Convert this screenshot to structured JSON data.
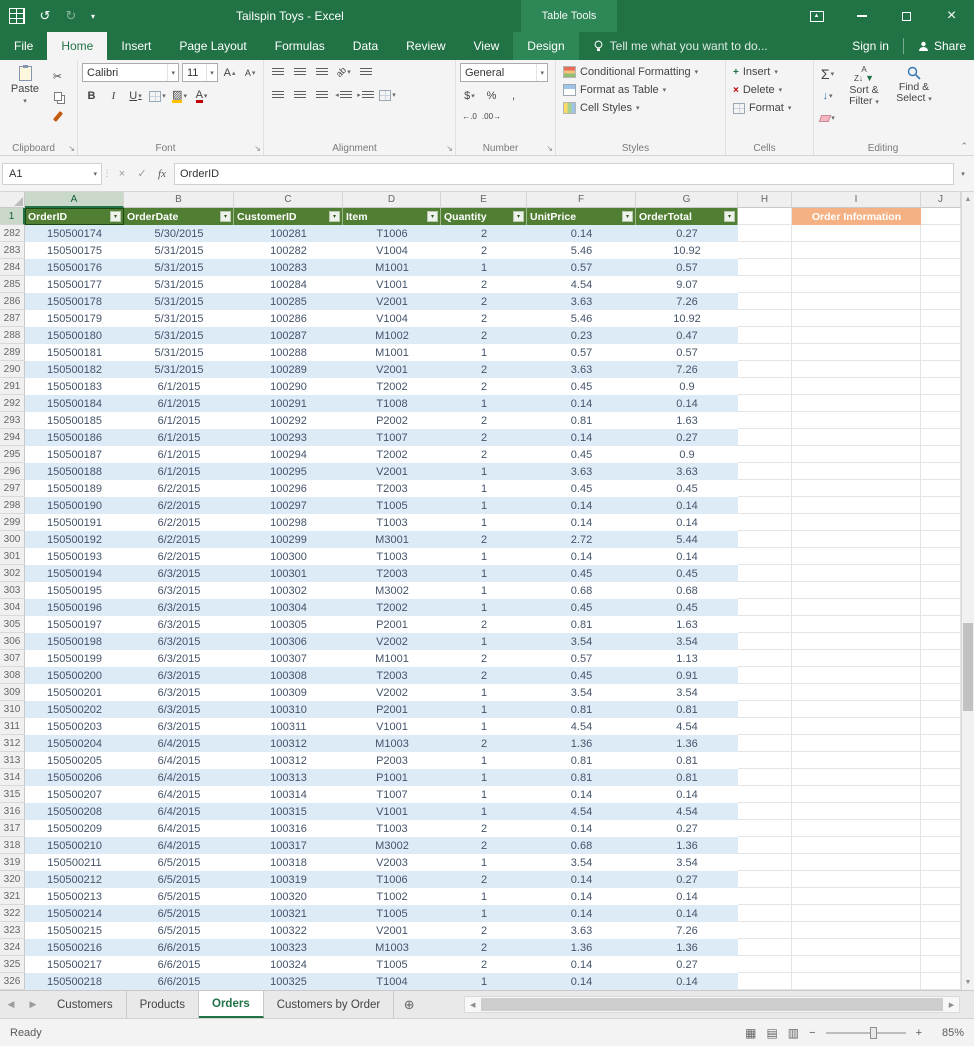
{
  "window": {
    "title": "Tailspin Toys - Excel",
    "context_label": "Table Tools"
  },
  "ribbon": {
    "tabs": [
      "File",
      "Home",
      "Insert",
      "Page Layout",
      "Formulas",
      "Data",
      "Review",
      "View",
      "Design"
    ],
    "tell_me": "Tell me what you want to do...",
    "sign_in": "Sign in",
    "share": "Share",
    "groups": {
      "clipboard": "Clipboard",
      "font": "Font",
      "alignment": "Alignment",
      "number": "Number",
      "styles": "Styles",
      "cells": "Cells",
      "editing": "Editing"
    },
    "buttons": {
      "paste": "Paste",
      "conditional_formatting": "Conditional Formatting",
      "format_as_table": "Format as Table",
      "cell_styles": "Cell Styles",
      "insert": "Insert",
      "delete": "Delete",
      "format": "Format",
      "sort_filter": "Sort & Filter",
      "find_select": "Find & Select"
    },
    "font_name": "Calibri",
    "font_size": "11",
    "number_format": "General"
  },
  "formula_bar": {
    "name_box": "A1",
    "content": "OrderID"
  },
  "sheet": {
    "columns": [
      "A",
      "B",
      "C",
      "D",
      "E",
      "F",
      "G",
      "H",
      "I",
      "J"
    ],
    "frozen_row_number": "1",
    "table_headers": [
      "OrderID",
      "OrderDate",
      "CustomerID",
      "Item",
      "Quantity",
      "UnitPrice",
      "OrderTotal"
    ],
    "order_info_header": "Order Information",
    "rows": [
      {
        "n": 282,
        "c": [
          "150500174",
          "5/30/2015",
          "100281",
          "T1006",
          "2",
          "0.14",
          "0.27"
        ]
      },
      {
        "n": 283,
        "c": [
          "150500175",
          "5/31/2015",
          "100282",
          "V1004",
          "2",
          "5.46",
          "10.92"
        ]
      },
      {
        "n": 284,
        "c": [
          "150500176",
          "5/31/2015",
          "100283",
          "M1001",
          "1",
          "0.57",
          "0.57"
        ]
      },
      {
        "n": 285,
        "c": [
          "150500177",
          "5/31/2015",
          "100284",
          "V1001",
          "2",
          "4.54",
          "9.07"
        ]
      },
      {
        "n": 286,
        "c": [
          "150500178",
          "5/31/2015",
          "100285",
          "V2001",
          "2",
          "3.63",
          "7.26"
        ]
      },
      {
        "n": 287,
        "c": [
          "150500179",
          "5/31/2015",
          "100286",
          "V1004",
          "2",
          "5.46",
          "10.92"
        ]
      },
      {
        "n": 288,
        "c": [
          "150500180",
          "5/31/2015",
          "100287",
          "M1002",
          "2",
          "0.23",
          "0.47"
        ]
      },
      {
        "n": 289,
        "c": [
          "150500181",
          "5/31/2015",
          "100288",
          "M1001",
          "1",
          "0.57",
          "0.57"
        ]
      },
      {
        "n": 290,
        "c": [
          "150500182",
          "5/31/2015",
          "100289",
          "V2001",
          "2",
          "3.63",
          "7.26"
        ]
      },
      {
        "n": 291,
        "c": [
          "150500183",
          "6/1/2015",
          "100290",
          "T2002",
          "2",
          "0.45",
          "0.9"
        ]
      },
      {
        "n": 292,
        "c": [
          "150500184",
          "6/1/2015",
          "100291",
          "T1008",
          "1",
          "0.14",
          "0.14"
        ]
      },
      {
        "n": 293,
        "c": [
          "150500185",
          "6/1/2015",
          "100292",
          "P2002",
          "2",
          "0.81",
          "1.63"
        ]
      },
      {
        "n": 294,
        "c": [
          "150500186",
          "6/1/2015",
          "100293",
          "T1007",
          "2",
          "0.14",
          "0.27"
        ]
      },
      {
        "n": 295,
        "c": [
          "150500187",
          "6/1/2015",
          "100294",
          "T2002",
          "2",
          "0.45",
          "0.9"
        ]
      },
      {
        "n": 296,
        "c": [
          "150500188",
          "6/1/2015",
          "100295",
          "V2001",
          "1",
          "3.63",
          "3.63"
        ]
      },
      {
        "n": 297,
        "c": [
          "150500189",
          "6/2/2015",
          "100296",
          "T2003",
          "1",
          "0.45",
          "0.45"
        ]
      },
      {
        "n": 298,
        "c": [
          "150500190",
          "6/2/2015",
          "100297",
          "T1005",
          "1",
          "0.14",
          "0.14"
        ]
      },
      {
        "n": 299,
        "c": [
          "150500191",
          "6/2/2015",
          "100298",
          "T1003",
          "1",
          "0.14",
          "0.14"
        ]
      },
      {
        "n": 300,
        "c": [
          "150500192",
          "6/2/2015",
          "100299",
          "M3001",
          "2",
          "2.72",
          "5.44"
        ]
      },
      {
        "n": 301,
        "c": [
          "150500193",
          "6/2/2015",
          "100300",
          "T1003",
          "1",
          "0.14",
          "0.14"
        ]
      },
      {
        "n": 302,
        "c": [
          "150500194",
          "6/3/2015",
          "100301",
          "T2003",
          "1",
          "0.45",
          "0.45"
        ]
      },
      {
        "n": 303,
        "c": [
          "150500195",
          "6/3/2015",
          "100302",
          "M3002",
          "1",
          "0.68",
          "0.68"
        ]
      },
      {
        "n": 304,
        "c": [
          "150500196",
          "6/3/2015",
          "100304",
          "T2002",
          "1",
          "0.45",
          "0.45"
        ]
      },
      {
        "n": 305,
        "c": [
          "150500197",
          "6/3/2015",
          "100305",
          "P2001",
          "2",
          "0.81",
          "1.63"
        ]
      },
      {
        "n": 306,
        "c": [
          "150500198",
          "6/3/2015",
          "100306",
          "V2002",
          "1",
          "3.54",
          "3.54"
        ]
      },
      {
        "n": 307,
        "c": [
          "150500199",
          "6/3/2015",
          "100307",
          "M1001",
          "2",
          "0.57",
          "1.13"
        ]
      },
      {
        "n": 308,
        "c": [
          "150500200",
          "6/3/2015",
          "100308",
          "T2003",
          "2",
          "0.45",
          "0.91"
        ]
      },
      {
        "n": 309,
        "c": [
          "150500201",
          "6/3/2015",
          "100309",
          "V2002",
          "1",
          "3.54",
          "3.54"
        ]
      },
      {
        "n": 310,
        "c": [
          "150500202",
          "6/3/2015",
          "100310",
          "P2001",
          "1",
          "0.81",
          "0.81"
        ]
      },
      {
        "n": 311,
        "c": [
          "150500203",
          "6/3/2015",
          "100311",
          "V1001",
          "1",
          "4.54",
          "4.54"
        ]
      },
      {
        "n": 312,
        "c": [
          "150500204",
          "6/4/2015",
          "100312",
          "M1003",
          "2",
          "1.36",
          "1.36"
        ]
      },
      {
        "n": 313,
        "c": [
          "150500205",
          "6/4/2015",
          "100312",
          "P2003",
          "1",
          "0.81",
          "0.81"
        ]
      },
      {
        "n": 314,
        "c": [
          "150500206",
          "6/4/2015",
          "100313",
          "P1001",
          "1",
          "0.81",
          "0.81"
        ]
      },
      {
        "n": 315,
        "c": [
          "150500207",
          "6/4/2015",
          "100314",
          "T1007",
          "1",
          "0.14",
          "0.14"
        ]
      },
      {
        "n": 316,
        "c": [
          "150500208",
          "6/4/2015",
          "100315",
          "V1001",
          "1",
          "4.54",
          "4.54"
        ]
      },
      {
        "n": 317,
        "c": [
          "150500209",
          "6/4/2015",
          "100316",
          "T1003",
          "2",
          "0.14",
          "0.27"
        ]
      },
      {
        "n": 318,
        "c": [
          "150500210",
          "6/4/2015",
          "100317",
          "M3002",
          "2",
          "0.68",
          "1.36"
        ]
      },
      {
        "n": 319,
        "c": [
          "150500211",
          "6/5/2015",
          "100318",
          "V2003",
          "1",
          "3.54",
          "3.54"
        ]
      },
      {
        "n": 320,
        "c": [
          "150500212",
          "6/5/2015",
          "100319",
          "T1006",
          "2",
          "0.14",
          "0.27"
        ]
      },
      {
        "n": 321,
        "c": [
          "150500213",
          "6/5/2015",
          "100320",
          "T1002",
          "1",
          "0.14",
          "0.14"
        ]
      },
      {
        "n": 322,
        "c": [
          "150500214",
          "6/5/2015",
          "100321",
          "T1005",
          "1",
          "0.14",
          "0.14"
        ]
      },
      {
        "n": 323,
        "c": [
          "150500215",
          "6/5/2015",
          "100322",
          "V2001",
          "2",
          "3.63",
          "7.26"
        ]
      },
      {
        "n": 324,
        "c": [
          "150500216",
          "6/6/2015",
          "100323",
          "M1003",
          "2",
          "1.36",
          "1.36"
        ]
      },
      {
        "n": 325,
        "c": [
          "150500217",
          "6/6/2015",
          "100324",
          "T1005",
          "2",
          "0.14",
          "0.27"
        ]
      },
      {
        "n": 326,
        "c": [
          "150500218",
          "6/6/2015",
          "100325",
          "T1004",
          "1",
          "0.14",
          "0.14"
        ]
      }
    ]
  },
  "sheet_tabs": {
    "tabs": [
      "Customers",
      "Products",
      "Orders",
      "Customers by Order"
    ],
    "active": "Orders"
  },
  "status_bar": {
    "mode": "Ready",
    "zoom": "85%"
  }
}
